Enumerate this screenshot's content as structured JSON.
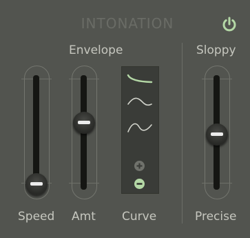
{
  "panel": {
    "title": "INTONATION",
    "power_icon": "power-icon",
    "accent_color": "#b4d8a6"
  },
  "envelope": {
    "label": "Envelope",
    "speed": {
      "label": "Speed",
      "level": 0.0
    },
    "amount": {
      "label": "Amt",
      "level": 0.62
    }
  },
  "curve": {
    "label": "Curve",
    "options": [
      {
        "name": "curve-slow-attack-icon",
        "selected": true
      },
      {
        "name": "curve-s-shape-icon",
        "selected": false
      },
      {
        "name": "curve-wave-icon",
        "selected": false
      }
    ],
    "add_icon": "plus-circle-icon",
    "remove_icon": "minus-circle-icon"
  },
  "sloppy": {
    "top_label": "Sloppy",
    "bottom_label": "Precise",
    "level": 0.5
  }
}
